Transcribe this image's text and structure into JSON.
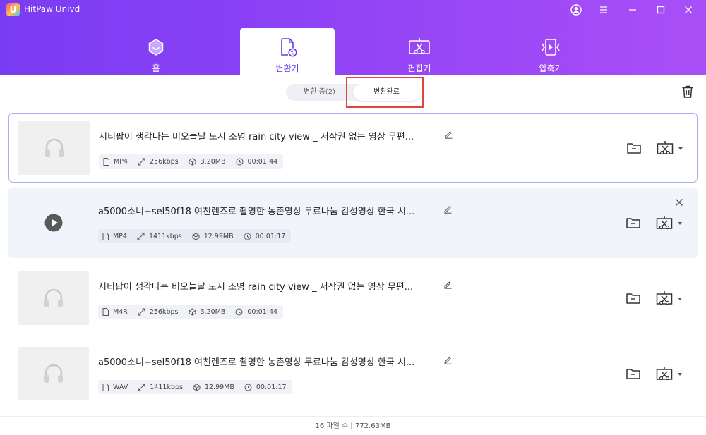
{
  "app": {
    "title": "HitPaw Univd",
    "logo_letter": "U"
  },
  "window_controls": [
    "account-icon",
    "menu-icon",
    "minimize-icon",
    "maximize-icon",
    "close-icon"
  ],
  "nav_tabs": [
    {
      "label": "홈",
      "icon": "home-icon",
      "active": false
    },
    {
      "label": "변환기",
      "icon": "converter-icon",
      "active": true
    },
    {
      "label": "편집기",
      "icon": "editor-icon",
      "active": false
    },
    {
      "label": "압축기",
      "icon": "compressor-icon",
      "active": false
    }
  ],
  "subtabs": {
    "converting": "변한 중(2)",
    "converted": "변환완료",
    "selected": "converted"
  },
  "files": [
    {
      "title": "시티팝이 생각나는 비오늘날 도시 조명 rain city view _ 저작권 없는 영상 무편...",
      "format": "MP4",
      "bitrate": "256kbps",
      "size": "3.20MB",
      "duration": "00:01:44",
      "thumb": "audio-icon",
      "state": "selected"
    },
    {
      "title": "a5000소니+sel50f18 여친렌즈로 촬영한 농촌영상 무료나눔 감성영상 한국 시...",
      "format": "MP4",
      "bitrate": "1411kbps",
      "size": "12.99MB",
      "duration": "00:01:17",
      "thumb": "play-icon",
      "state": "hover"
    },
    {
      "title": "시티팝이 생각나는 비오늘날 도시 조명 rain city view _ 저작권 없는 영상 무편...",
      "format": "M4R",
      "bitrate": "256kbps",
      "size": "3.20MB",
      "duration": "00:01:44",
      "thumb": "audio-icon",
      "state": "normal"
    },
    {
      "title": "a5000소니+sel50f18 여친렌즈로 촬영한 농촌영상 무료나눔 감성영상 한국 시...",
      "format": "WAV",
      "bitrate": "1411kbps",
      "size": "12.99MB",
      "duration": "00:01:17",
      "thumb": "audio-icon",
      "state": "normal"
    }
  ],
  "footer": {
    "summary": "16 파일 수 | 772.63MB"
  },
  "colors": {
    "header_gradient_start": "#7a3cf2",
    "header_gradient_end": "#a94ff7",
    "active_tab_text": "#6a3ae8",
    "highlight_box": "#e0463b",
    "selected_row_border": "#a7b0f2"
  }
}
